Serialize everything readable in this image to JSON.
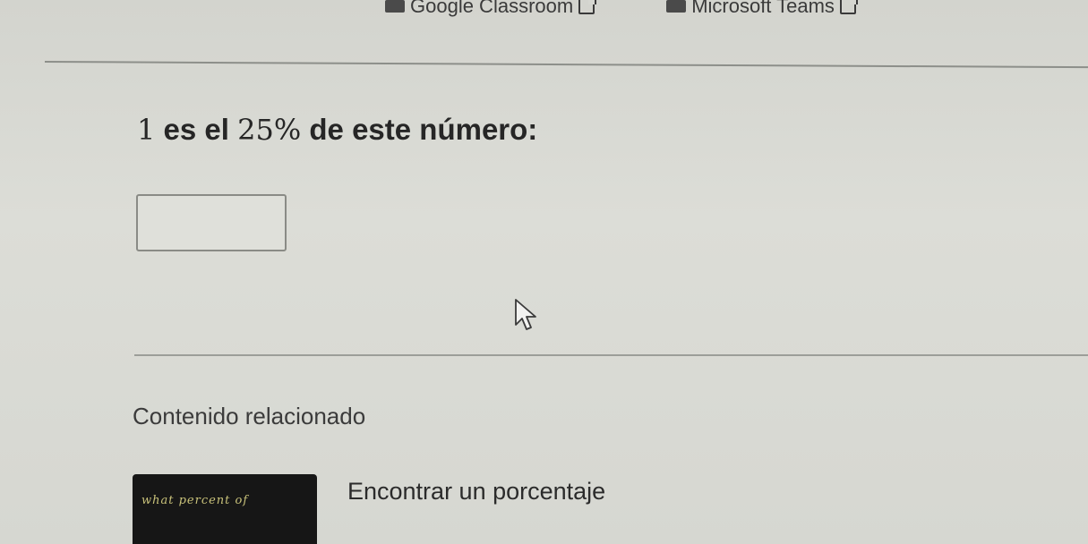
{
  "header": {
    "links": [
      {
        "label": "Google Classroom",
        "icon": "google-classroom-icon"
      },
      {
        "label": "Microsoft Teams",
        "icon": "microsoft-teams-icon"
      }
    ]
  },
  "question": {
    "prefix": "1",
    "text_a": " es el ",
    "percent": "25%",
    "text_b": " de este número:"
  },
  "answer": {
    "value": ""
  },
  "related": {
    "title": "Contenido relacionado",
    "items": [
      {
        "title": "Encontrar un porcentaje",
        "thumbnail_text": "what percent of"
      }
    ]
  },
  "colors": {
    "background": "#d8d9d3",
    "text": "#262626",
    "thumbnail_bg": "#161616",
    "thumbnail_chalk": "#c9c27a"
  }
}
